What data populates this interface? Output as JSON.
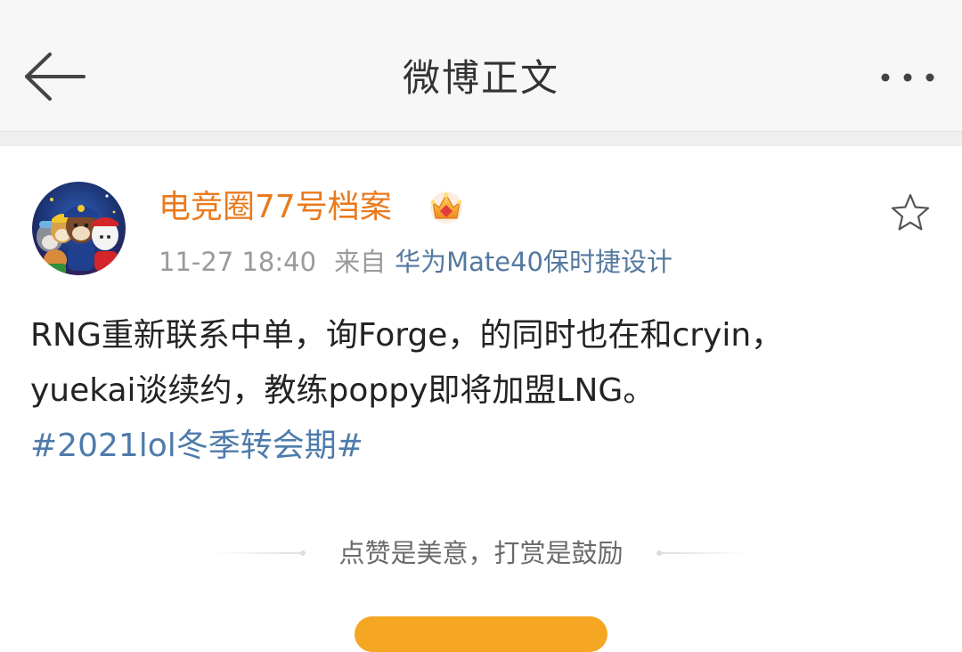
{
  "header": {
    "title": "微博正文"
  },
  "post": {
    "username": "电竞圈77号档案",
    "time": "11-27 18:40",
    "from_label": "来自",
    "device": "华为Mate40保时捷设计",
    "content_lines": [
      "RNG重新联系中单，询Forge，的同时也在和cryin，",
      "yuekai谈续约，教练poppy即将加盟LNG。"
    ],
    "hashtag": "#2021lol冬季转会期#"
  },
  "reward": {
    "tagline": "点赞是美意，打赏是鼓励"
  },
  "colors": {
    "username": "#ea7a1c",
    "link": "#54799f",
    "hashtag": "#4e7bab",
    "reward_button": "#f5a623"
  },
  "icons": {
    "back": "arrow-left-icon",
    "more": "more-dots-icon",
    "badge": "crown-icon",
    "favorite": "star-outline-icon"
  }
}
